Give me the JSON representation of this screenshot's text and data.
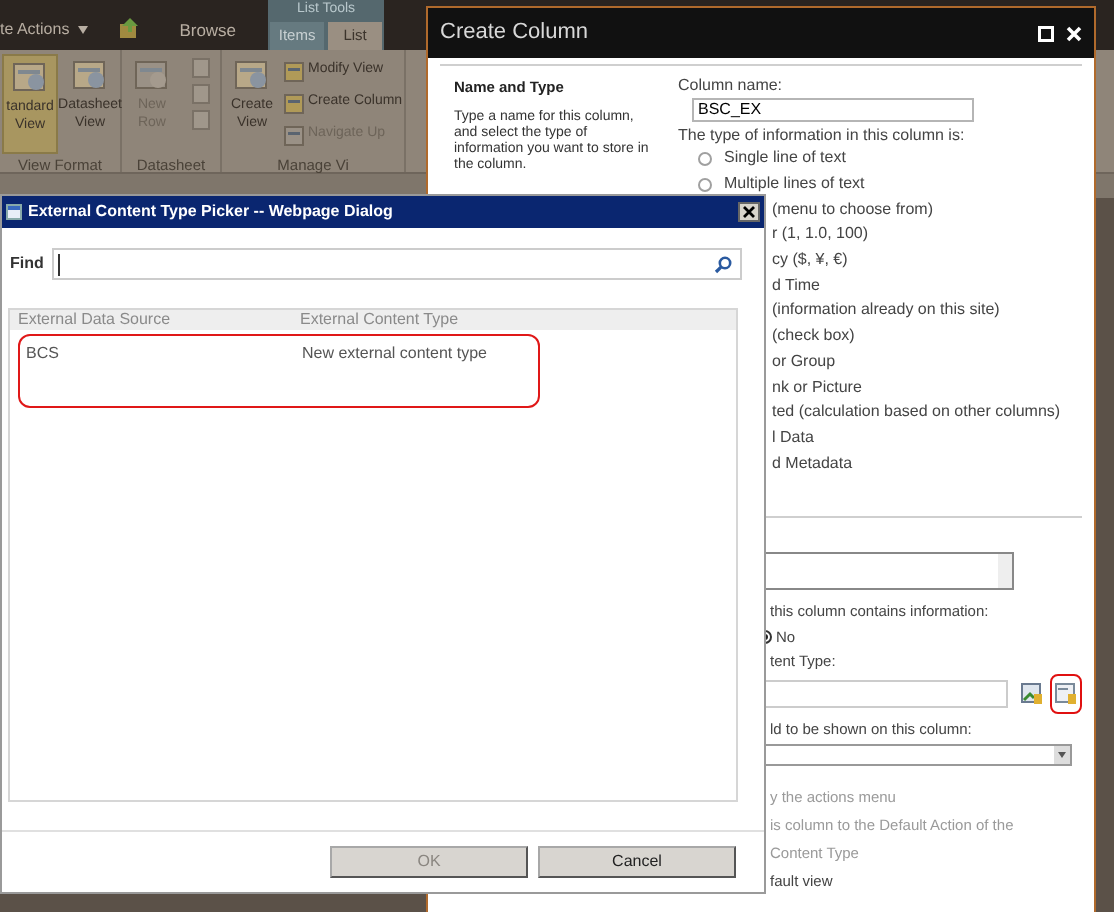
{
  "ribbon": {
    "site_actions": "te Actions",
    "browse_tab": "Browse",
    "contextual_group": "List Tools",
    "tabs": [
      {
        "label": "Items",
        "selected": false
      },
      {
        "label": "List",
        "selected": true
      }
    ],
    "groups": [
      {
        "label": "View Format",
        "buttons": [
          {
            "label": "tandard View",
            "kind": "large",
            "selected": true,
            "disabled": false
          },
          {
            "label": "Datasheet View",
            "kind": "large",
            "selected": false,
            "disabled": false
          }
        ]
      },
      {
        "label": "Datasheet",
        "buttons": [
          {
            "label": "New Row",
            "kind": "large",
            "selected": false,
            "disabled": true
          },
          {
            "kind": "stack",
            "disabled": true
          }
        ]
      },
      {
        "label": "Manage Vi",
        "buttons": [
          {
            "label": "Create View",
            "kind": "large",
            "selected": false,
            "disabled": false
          },
          {
            "label": "Modify View",
            "kind": "small",
            "selected": false,
            "disabled": false
          },
          {
            "label": "Create Column",
            "kind": "small",
            "selected": false,
            "disabled": false
          },
          {
            "label": "Navigate Up",
            "kind": "small",
            "selected": false,
            "disabled": true
          }
        ]
      }
    ]
  },
  "create_column": {
    "title": "Create Column",
    "section_title": "Name and Type",
    "section_description": "Type a name for this column, and select the type of information you want to store in the column.",
    "name_label": "Column name:",
    "name_value": "BSC_EX",
    "type_label": "The type of information in this column is:",
    "types": [
      {
        "label": "Single line of text",
        "kind": "radio",
        "selected": false
      },
      {
        "label": "Multiple lines of text",
        "kind": "radio",
        "selected": false
      },
      {
        "label": "(menu to choose from)",
        "kind": "fragment"
      },
      {
        "label": "r (1, 1.0, 100)",
        "kind": "fragment"
      },
      {
        "label": "cy ($, ¥, €)",
        "kind": "fragment"
      },
      {
        "label": "d Time",
        "kind": "fragment"
      },
      {
        "label": "(information already on this site)",
        "kind": "fragment"
      },
      {
        "label": "(check box)",
        "kind": "fragment"
      },
      {
        "label": "or Group",
        "kind": "fragment"
      },
      {
        "label": "nk or Picture",
        "kind": "fragment"
      },
      {
        "label": "ted (calculation based on other columns)",
        "kind": "fragment"
      },
      {
        "label": "l Data",
        "kind": "fragment"
      },
      {
        "label": "d Metadata",
        "kind": "fragment"
      }
    ],
    "settings": [
      {
        "kind": "textarea"
      },
      {
        "kind": "label",
        "text": "this column contains information:"
      },
      {
        "kind": "radio",
        "text": "No",
        "selected": true
      },
      {
        "kind": "label",
        "text": "tent Type:"
      },
      {
        "kind": "picker",
        "highlighted": true
      },
      {
        "kind": "label",
        "text": "ld to be shown on this column:"
      },
      {
        "kind": "select"
      },
      {
        "kind": "note",
        "text": "y the actions menu",
        "disabled": true
      },
      {
        "kind": "note",
        "text": "is column to the Default Action of the",
        "disabled": true
      },
      {
        "kind": "note",
        "text": "Content Type",
        "disabled": true
      },
      {
        "kind": "note",
        "text": "fault view",
        "disabled": false
      }
    ]
  },
  "picker": {
    "title": "External Content Type Picker -- Webpage Dialog",
    "find_label": "Find",
    "columns": [
      "External Data Source",
      "External Content Type"
    ],
    "rows": [
      {
        "cells": [
          "BCS",
          "New external content type"
        ],
        "highlighted": true
      }
    ],
    "buttons": [
      {
        "label": "OK",
        "disabled": true
      },
      {
        "label": "Cancel",
        "disabled": false
      }
    ]
  }
}
